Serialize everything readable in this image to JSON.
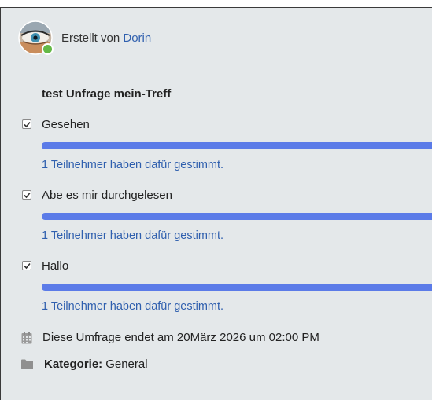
{
  "header": {
    "created_by_label": "Erstellt von",
    "author_name": "Dorin"
  },
  "poll": {
    "title": "test Unfrage mein-Treff",
    "options": [
      {
        "label": "Gesehen",
        "votes_text": "1 Teilnehmer haben dafür gestimmt.",
        "percent": 100,
        "checked": true
      },
      {
        "label": "Abe es mir durchgelesen",
        "votes_text": "1 Teilnehmer haben dafür gestimmt.",
        "percent": 100,
        "checked": true
      },
      {
        "label": "Hallo",
        "votes_text": "1 Teilnehmer haben dafür gestimmt.",
        "percent": 100,
        "checked": true
      }
    ],
    "end_text": "Diese Umfrage endet am 20März 2026 um 02:00 PM",
    "category_label": "Kategorie:",
    "category_value": "General"
  },
  "icons": {
    "calendar": "calendar-icon",
    "folder": "folder-icon",
    "checkbox": "checkbox-icon",
    "online": "online-status-icon"
  },
  "colors": {
    "background": "#e4e8ea",
    "link": "#2f5fae",
    "bar_fill": "#5b7be8",
    "online": "#64b946"
  }
}
